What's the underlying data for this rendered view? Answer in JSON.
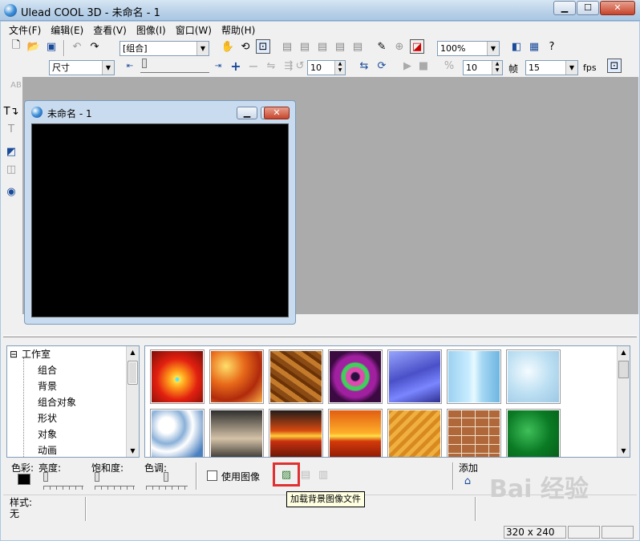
{
  "window": {
    "title": "Ulead COOL 3D - 未命名 - 1",
    "min": "▁",
    "max": "☐",
    "close": "✕"
  },
  "menu": [
    "文件(F)",
    "编辑(E)",
    "查看(V)",
    "图像(I)",
    "窗口(W)",
    "帮助(H)"
  ],
  "toolbar": {
    "object_combo": "[组合]",
    "zoom_combo": "100%",
    "size_combo": "尺寸",
    "spin1": "10",
    "spin2": "10",
    "frame_label": "帧",
    "frame_combo": "15",
    "fps_label": "fps"
  },
  "document": {
    "title": "未命名 - 1"
  },
  "tree": {
    "root": "工作室",
    "items": [
      "组合",
      "背景",
      "组合对象",
      "形状",
      "对象",
      "动画"
    ],
    "expander": "⊟"
  },
  "gallery": {
    "thumbs": [
      {
        "name": "thumb-sun-burst",
        "bg": "radial-gradient(circle at 50% 55%, #4ee8ff 0 4%, #ffe14a 6%, #ff9a1a 22%, #e22010 52%, #8c1008 90%)"
      },
      {
        "name": "thumb-fire-texture",
        "bg": "radial-gradient(circle at 30% 30%, #ffdf6a, #e86a1a 35%, #b02a0c 65%, #ffb84a)"
      },
      {
        "name": "thumb-wood-texture",
        "bg": "repeating-linear-gradient(35deg, #8a4a14 0 6px, #c37a2a 6px 12px, #6a3206 12px 16px)"
      },
      {
        "name": "thumb-swirl",
        "bg": "radial-gradient(circle at 50% 50%, #2a1040 0 10%, #e04ab0 14% 24%, #3fd05a 28% 36%, #a020a0 40% 55%, #3a0a40 70%)"
      },
      {
        "name": "thumb-water-ripple",
        "bg": "linear-gradient(160deg, #9aa8ff, #4a50c8 45%, #7a86ff 70%, #2a2a8a)"
      },
      {
        "name": "thumb-ice-blue",
        "bg": "linear-gradient(90deg, #9ad0f0 0%, #c8ecff 40%, #e8faff 50%, #a6d8f4 65%, #6ab4e0 100%)"
      },
      {
        "name": "thumb-frost",
        "bg": "radial-gradient(circle at 40% 40%, #f4fbff, #bcdff2 50%, #9ac6e4)"
      },
      {
        "name": "thumb-clouds",
        "bg": "radial-gradient(circle at 30% 30%, #ffffff 0 15%, #8ab0d8 35%, #ffffff 50%, #4a80c0 80%)"
      },
      {
        "name": "thumb-dark-sky",
        "bg": "linear-gradient(#2a2a2a, #d4c2a8 55%, #1a1a1a)"
      },
      {
        "name": "thumb-sunset-sea",
        "bg": "linear-gradient(#1a1a1a 0%, #d84a10 40%, #ffcf3a 50%, #c83010 60%, #4a1004 100%)"
      },
      {
        "name": "thumb-sunset-sky",
        "bg": "linear-gradient(#e05a10 0%, #ffb02a 45%, #ffe24a 50%, #d43a0a 60%, #7a1404 100%)"
      },
      {
        "name": "thumb-sand-pattern",
        "bg": "repeating-linear-gradient(135deg, #d88a20 0 5px, #f0b040 5px 10px)"
      },
      {
        "name": "thumb-brick-wall",
        "bg": "repeating-linear-gradient(0deg, #f0e0c8 0 1px, transparent 1px 11px), repeating-linear-gradient(90deg, #f0e0c8 0 1px, transparent 1px 17px), #b0683a"
      },
      {
        "name": "thumb-green-marble",
        "bg": "radial-gradient(circle at 40% 40%, #3fbf5a, #0a7a24 50%, #065a18)"
      }
    ]
  },
  "panel": {
    "color_label": "色彩:",
    "brightness_label": "亮度:",
    "saturation_label": "饱和度:",
    "hue_label": "色调:",
    "use_image_label": "使用图像",
    "add_label": "添加",
    "tooltip": "加载背景图像文件"
  },
  "status": {
    "style_label": "样式:",
    "style_value": "无",
    "size": "320 x 240"
  },
  "watermark": "Bai 经验"
}
